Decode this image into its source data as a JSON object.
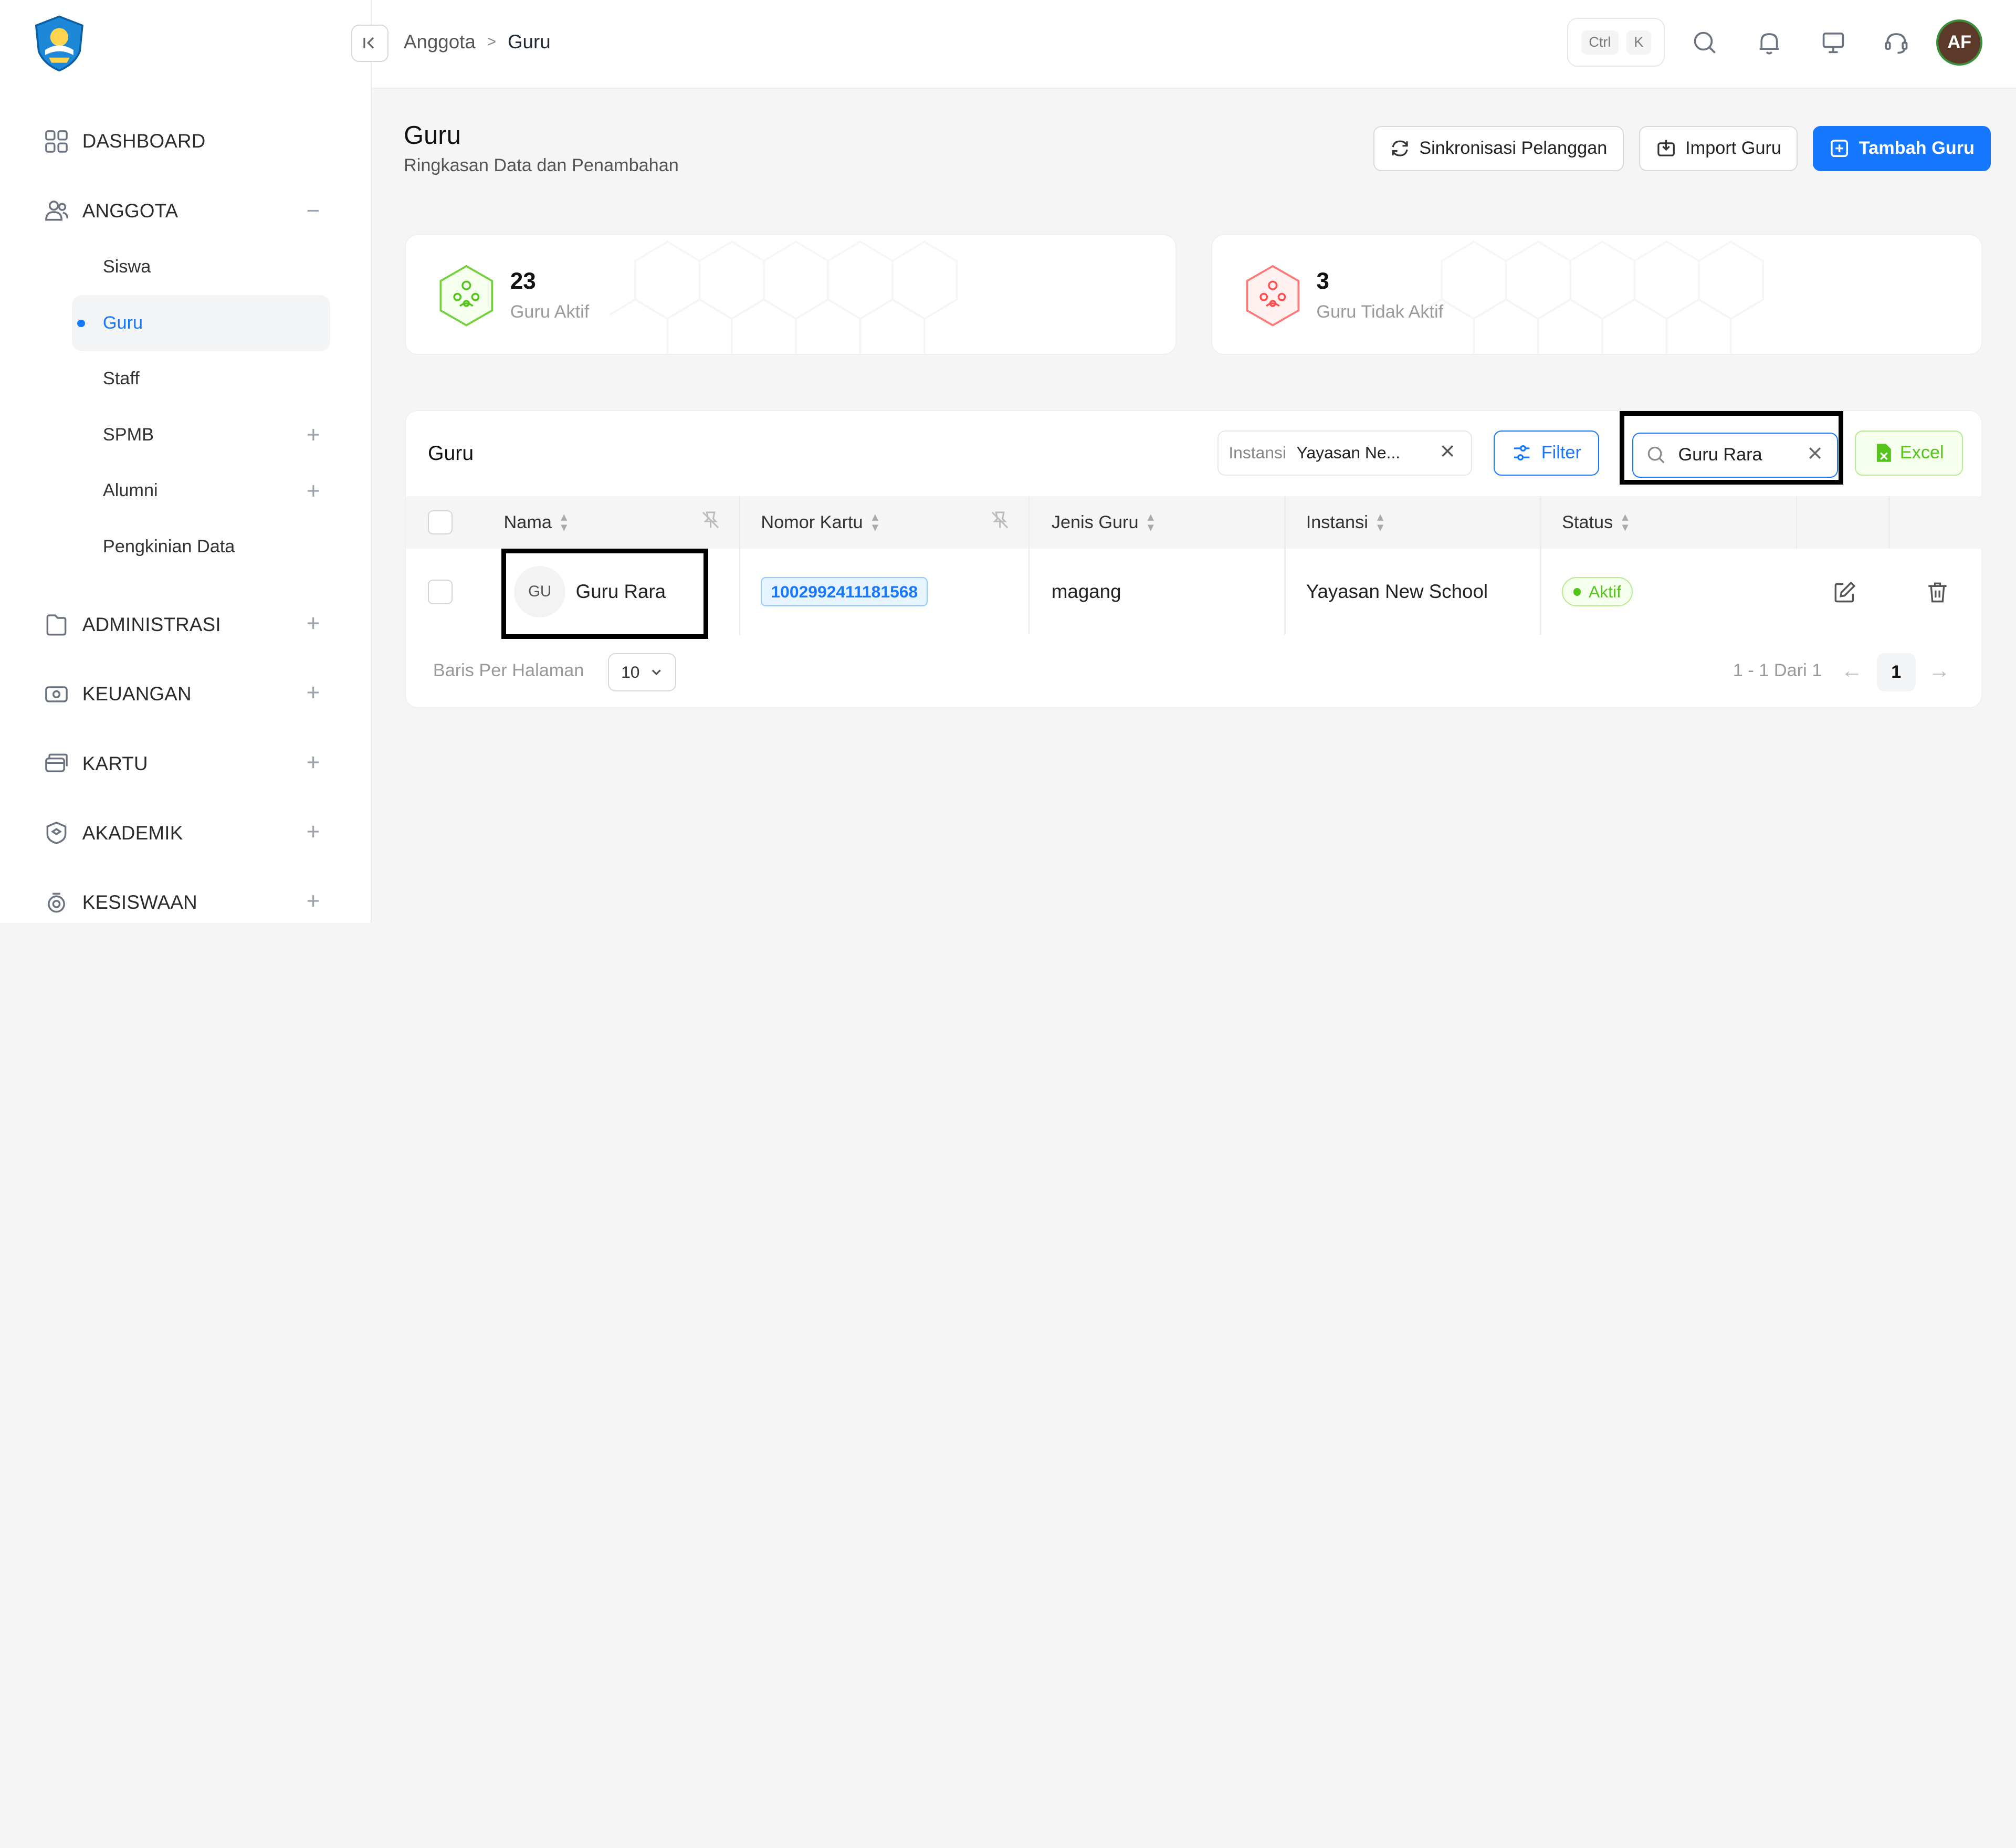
{
  "topbar": {
    "breadcrumb": [
      "Anggota",
      "Guru"
    ],
    "shortcut": [
      "Ctrl",
      "K"
    ],
    "avatar_initials": "AF"
  },
  "sidebar": {
    "items": [
      {
        "label": "DASHBOARD",
        "icon": "dashboard-icon",
        "toggle": ""
      },
      {
        "label": "ANGGOTA",
        "icon": "users-icon",
        "toggle": "−"
      },
      {
        "label": "ADMINISTRASI",
        "icon": "folder-icon",
        "toggle": "+"
      },
      {
        "label": "KEUANGAN",
        "icon": "money-icon",
        "toggle": "+"
      },
      {
        "label": "KARTU",
        "icon": "card-icon",
        "toggle": "+"
      },
      {
        "label": "AKADEMIK",
        "icon": "academic-icon",
        "toggle": "+"
      },
      {
        "label": "KESISWAAN",
        "icon": "student-icon",
        "toggle": "+"
      }
    ],
    "anggota_sub": [
      {
        "label": "Siswa",
        "toggle": ""
      },
      {
        "label": "Guru",
        "toggle": ""
      },
      {
        "label": "Staff",
        "toggle": ""
      },
      {
        "label": "SPMB",
        "toggle": "+"
      },
      {
        "label": "Alumni",
        "toggle": "+"
      },
      {
        "label": "Pengkinian Data",
        "toggle": ""
      }
    ]
  },
  "header": {
    "title": "Guru",
    "subtitle": "Ringkasan Data dan Penambahan",
    "buttons": {
      "sync": "Sinkronisasi Pelanggan",
      "import": "Import Guru",
      "add": "Tambah Guru"
    }
  },
  "stats": [
    {
      "value": "23",
      "label": "Guru Aktif",
      "color": "#52c41a"
    },
    {
      "value": "3",
      "label": "Guru Tidak Aktif",
      "color": "#ff4d4f"
    }
  ],
  "table": {
    "title": "Guru",
    "filter_chip": {
      "key": "Instansi",
      "value": "Yayasan Ne..."
    },
    "filter_label": "Filter",
    "search_value": "Guru Rara",
    "excel_label": "Excel",
    "columns": [
      "Nama",
      "Nomor Kartu",
      "Jenis Guru",
      "Instansi",
      "Status"
    ],
    "rows": [
      {
        "initials": "GU",
        "name": "Guru Rara",
        "card_number": "1002992411181568",
        "type": "magang",
        "institution": "Yayasan New School",
        "status": "Aktif"
      }
    ],
    "rows_per_page_label": "Baris Per Halaman",
    "rows_per_page": "10",
    "pager_info": "1 - 1 Dari 1",
    "current_page": "1"
  },
  "colors": {
    "primary": "#1677ff",
    "success": "#52c41a",
    "danger": "#ff4d4f"
  }
}
